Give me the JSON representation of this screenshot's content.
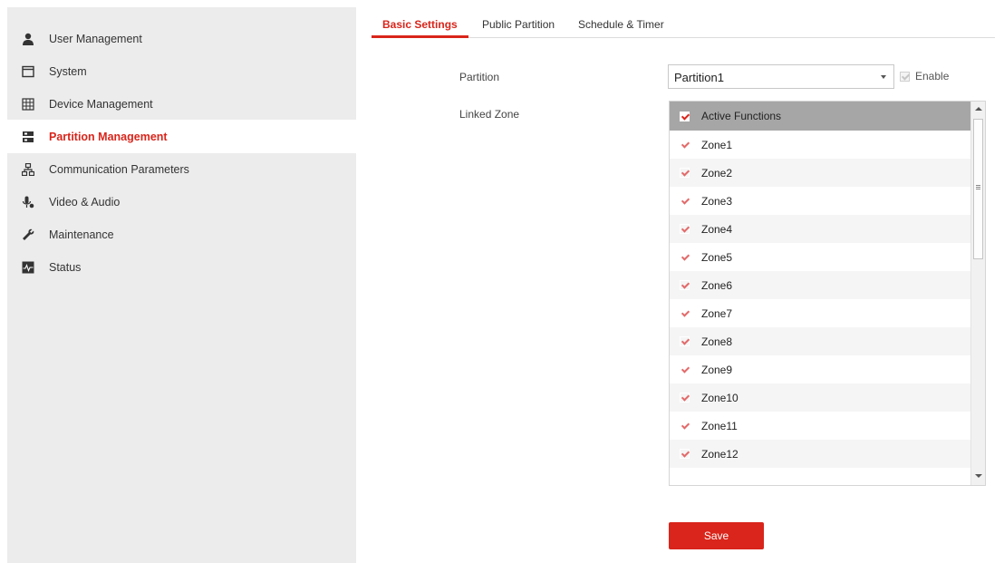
{
  "sidebar": {
    "items": [
      {
        "label": "User Management",
        "icon": "user-icon"
      },
      {
        "label": "System",
        "icon": "window-icon"
      },
      {
        "label": "Device Management",
        "icon": "grid-device-icon"
      },
      {
        "label": "Partition Management",
        "icon": "partition-icon",
        "active": true
      },
      {
        "label": "Communication Parameters",
        "icon": "network-icon"
      },
      {
        "label": "Video & Audio",
        "icon": "microphone-icon"
      },
      {
        "label": "Maintenance",
        "icon": "wrench-icon"
      },
      {
        "label": "Status",
        "icon": "pulse-icon"
      }
    ]
  },
  "tabs": [
    {
      "label": "Basic Settings",
      "active": true
    },
    {
      "label": "Public Partition"
    },
    {
      "label": "Schedule & Timer"
    }
  ],
  "form": {
    "partition_label": "Partition",
    "partition_value": "Partition1",
    "enable_label": "Enable",
    "linked_zone_label": "Linked Zone"
  },
  "zones": {
    "header": "Active Functions",
    "items": [
      "Zone1",
      "Zone2",
      "Zone3",
      "Zone4",
      "Zone5",
      "Zone6",
      "Zone7",
      "Zone8",
      "Zone9",
      "Zone10",
      "Zone11",
      "Zone12"
    ]
  },
  "save_label": "Save",
  "colors": {
    "accent": "#d9251b",
    "sidebar_bg": "#ececec",
    "zone_header_bg": "#a6a6a6"
  }
}
